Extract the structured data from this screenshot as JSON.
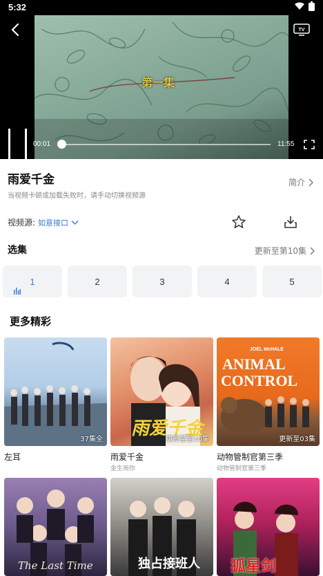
{
  "status": {
    "time": "5:32"
  },
  "player": {
    "episode_title": "第一集",
    "current_time": "00:01",
    "duration": "11:55",
    "progress": 0.001
  },
  "info": {
    "title": "雨爱千金",
    "intro_label": "简介",
    "hint": "当视频卡顿或加载失败时，请手动切换视频源",
    "source_label": "视频源:",
    "source_value": "如意接口"
  },
  "episodes": {
    "section_title": "选集",
    "updated_label": "更新至第10集",
    "items": [
      "1",
      "2",
      "3",
      "4",
      "5"
    ],
    "active_index": 0
  },
  "recommend": {
    "section_title": "更多精彩",
    "items": [
      {
        "name": "左耳",
        "sub": "",
        "badge": "37集全"
      },
      {
        "name": "雨爱千金",
        "sub": "金生雨你",
        "badge": "更新至第10集"
      },
      {
        "name": "动物管制官第三季",
        "sub": "动物管制官第三季",
        "badge": "更新至03集",
        "poster_text_1": "ANIMAL",
        "poster_text_2": "CONTROL",
        "poster_top": "JOEL McHALE"
      },
      {
        "name": "",
        "sub": "",
        "badge": "",
        "poster_text_1": "The Last Time"
      },
      {
        "name": "",
        "sub": "",
        "badge": "",
        "poster_text_1": "独占接班人"
      },
      {
        "name": "",
        "sub": "",
        "badge": "",
        "poster_text_1": "狐星剑"
      }
    ]
  },
  "colors": {
    "accent": "#3a7bd5",
    "episode_title": "#ffe24a"
  }
}
